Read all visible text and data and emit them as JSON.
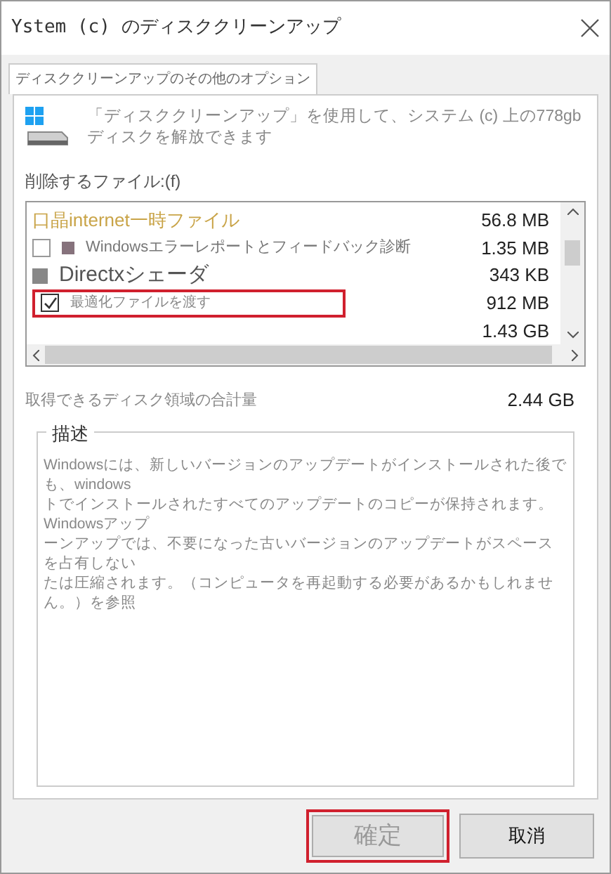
{
  "window": {
    "title": "Ystem (c) のディスククリーンアップ"
  },
  "tabs": [
    {
      "label": "ディスククリーンアップのその他のオプション",
      "selected": true
    }
  ],
  "intro": "「ディスククリーンアップ」を使用して、システム (c) 上の778gbディスクを解放できます",
  "files_label": "削除するファイル:(f)",
  "files": [
    {
      "kind": "text",
      "label": "口晶internet一時ファイル",
      "size": "56.8 MB"
    },
    {
      "kind": "checkbox",
      "checked": false,
      "label": "Windowsエラーレポートとフィードバック診断",
      "size": "1.35 MB"
    },
    {
      "kind": "large",
      "label": "Directxシェーダ",
      "size": "343 KB"
    },
    {
      "kind": "checkbox",
      "checked": true,
      "label": "最適化ファイルを渡す",
      "size": "912 MB",
      "highlighted": true
    },
    {
      "kind": "blank",
      "size": "1.43 GB"
    }
  ],
  "total": {
    "label": "取得できるディスク領域の合計量",
    "value": "2.44 GB"
  },
  "description": {
    "title": "描述",
    "lines": [
      "Windowsには、新しいバージョンのアップデートがインストールされた後でも、windows",
      "トでインストールされたすべてのアップデートのコピーが保持されます。Windowsアップ",
      "ーンアップでは、不要になった古いバージョンのアップデートがスペースを占有しない",
      "たは圧縮されます。（コンピュータを再起動する必要があるかもしれません。）を参照"
    ]
  },
  "buttons": [
    {
      "label": "確定",
      "highlighted": true,
      "disabled": true
    },
    {
      "label": "取消",
      "highlighted": false,
      "disabled": false
    }
  ]
}
